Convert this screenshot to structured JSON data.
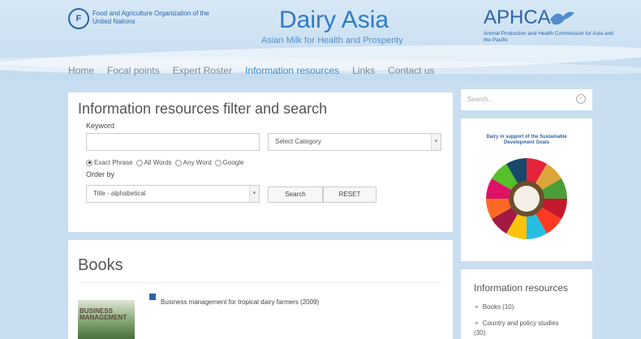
{
  "header": {
    "fao_text": "Food and Agriculture Organization of the United Nations",
    "title": "Dairy Asia",
    "subtitle": "Asian Milk for Health and Prosperity",
    "aphca_title": "APHCA",
    "aphca_sub": "Animal Production and Health Commission for Asia and the Pacific"
  },
  "nav": {
    "items": [
      "Home",
      "Focal points",
      "Expert Roster",
      "Information resources",
      "Links",
      "Contact us"
    ]
  },
  "filter": {
    "title": "Information resources filter and search",
    "keyword_label": "Keyword",
    "keyword_value": "",
    "category_selected": "Select Category",
    "radios": [
      "Exact Phrase",
      "All Words",
      "Any Word",
      "Google"
    ],
    "order_label": "Order by",
    "order_selected": "Title - alphabetical",
    "search_btn": "Search",
    "reset_btn": "RESET"
  },
  "books": {
    "title": "Books",
    "cover_text_1": "BUSINESS",
    "cover_text_2": "MANAGEMENT",
    "item_title": "Business management for tropical dairy farmers (2009)"
  },
  "sidebar": {
    "search_placeholder": "Search...",
    "sdg_title": "Dairy in support of the Sustainable Development Goals",
    "resources_title": "Information resources",
    "resources": [
      {
        "label": "Books (10)"
      },
      {
        "label": "Country and policy studies"
      },
      {
        "label": "(30)"
      }
    ]
  },
  "colors": {
    "accent": "#3a8ad0",
    "background": "#c9def0",
    "brand": "#2b64a8"
  }
}
